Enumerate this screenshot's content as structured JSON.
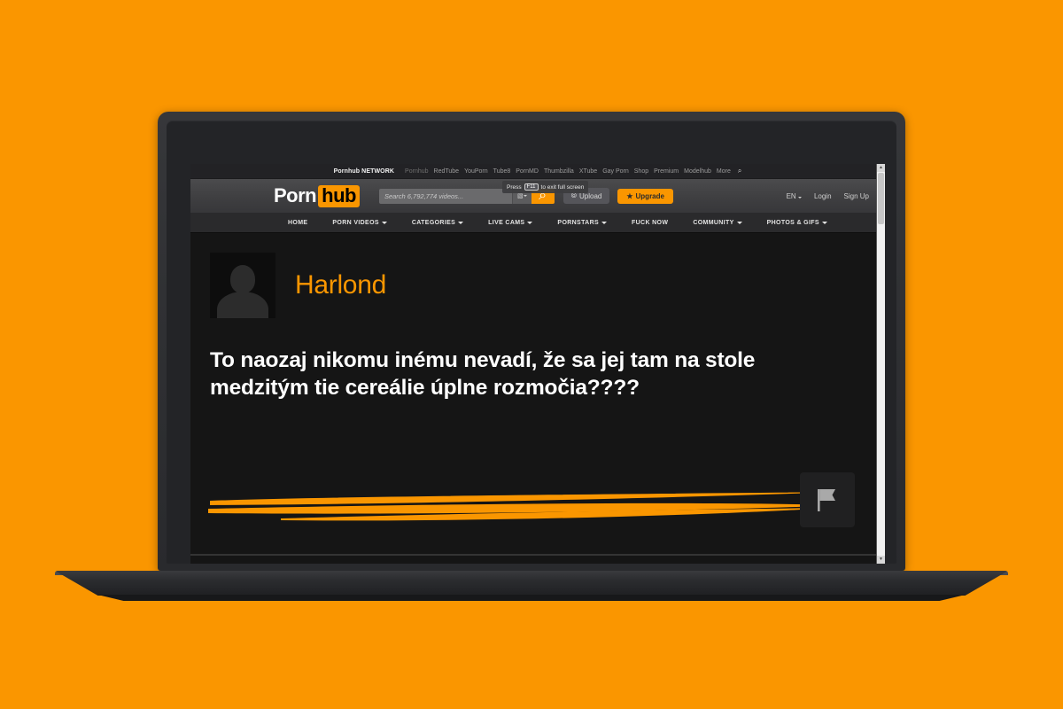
{
  "background_color": "#fa9600",
  "device": {
    "type": "laptop",
    "bezel_color": "#303134",
    "screen_background": "#0f0f0f"
  },
  "browser": {
    "fullscreen_toast": {
      "prefix": "Press",
      "key": "F11",
      "suffix": "to exit full screen"
    },
    "scrollbar": {
      "up_arrow": "▲",
      "down_arrow": "▼"
    }
  },
  "network_bar": {
    "brand": "Pornhub NETWORK",
    "links": [
      "Pornhub",
      "RedTube",
      "YouPorn",
      "Tube8",
      "PornMD",
      "Thumbzilla",
      "XTube",
      "Gay Porn",
      "Shop",
      "Premium",
      "Modelhub",
      "More"
    ],
    "search_icon": "⌕"
  },
  "header": {
    "logo": {
      "first": "Porn",
      "second": "hub",
      "highlight_color": "#fa9600"
    },
    "search": {
      "placeholder": "Search 6,792,774 videos...",
      "value": "",
      "filter_label": "",
      "search_icon": "⌕"
    },
    "upload_label": "Upload",
    "upgrade_label": "Upgrade",
    "upgrade_star": "★",
    "language": "EN",
    "login_label": "Login",
    "signup_label": "Sign Up"
  },
  "main_nav": [
    {
      "label": "HOME",
      "has_caret": false
    },
    {
      "label": "PORN VIDEOS",
      "has_caret": true
    },
    {
      "label": "CATEGORIES",
      "has_caret": true
    },
    {
      "label": "LIVE CAMS",
      "has_caret": true
    },
    {
      "label": "PORNSTARS",
      "has_caret": true
    },
    {
      "label": "FUCK NOW",
      "has_caret": false
    },
    {
      "label": "COMMUNITY",
      "has_caret": true
    },
    {
      "label": "PHOTOS & GIFS",
      "has_caret": true
    }
  ],
  "profile": {
    "username": "Harlond",
    "username_color": "#fa9600",
    "avatar_alt": "default-user-silhouette",
    "quote": "To naozaj nikomu inému nevadí, že sa jej tam na stole medzitým tie cereálie úplne rozmočia????",
    "underline_color": "#fa9600",
    "report_icon": "flag"
  }
}
